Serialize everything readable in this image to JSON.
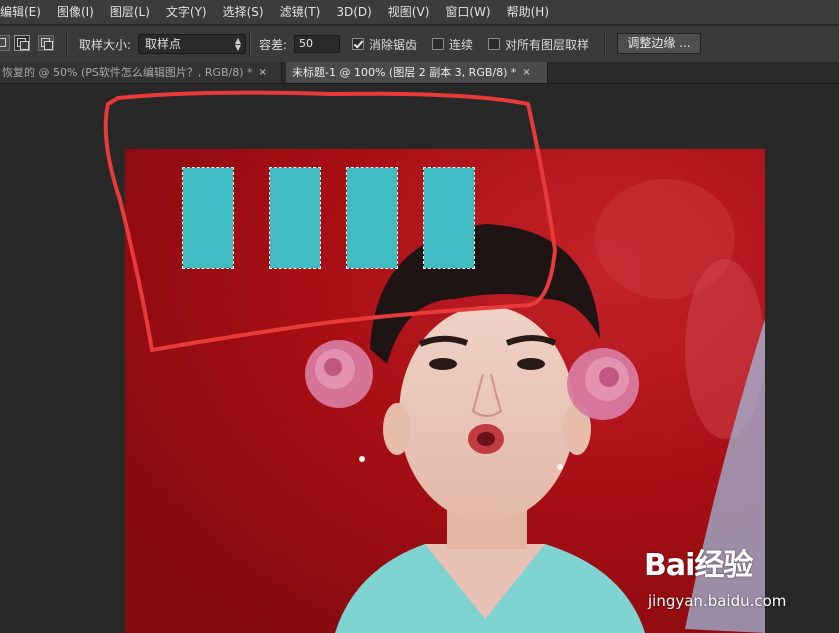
{
  "menu": {
    "items": [
      "编辑(E)",
      "图像(I)",
      "图层(L)",
      "文字(Y)",
      "选择(S)",
      "滤镜(T)",
      "3D(D)",
      "视图(V)",
      "窗口(W)",
      "帮助(H)"
    ]
  },
  "options": {
    "sample_size_label": "取样大小:",
    "sample_size_value": "取样点",
    "tolerance_label": "容差:",
    "tolerance_value": "50",
    "anti_alias_label": "消除锯齿",
    "anti_alias_checked": true,
    "contiguous_label": "连续",
    "contiguous_checked": false,
    "all_layers_label": "对所有图层取样",
    "all_layers_checked": false,
    "refine_edge_label": "调整边缘 ..."
  },
  "tabs": [
    {
      "label": "恢复的 @ 50% (PS软件怎么编辑图片？, RGB/8) *",
      "active": false
    },
    {
      "label": "未标题-1 @ 100% (图层 2 副本 3, RGB/8) *",
      "active": true
    }
  ],
  "tab_close_glyph": "×",
  "canvas": {
    "background_color": "#a40f13",
    "selection_fill_color": "#40bcc2",
    "selection_count": 4,
    "annotation_color": "#e83a3a"
  },
  "watermark": {
    "brand": "Bai经验",
    "url": "jingyan.baidu.com"
  }
}
